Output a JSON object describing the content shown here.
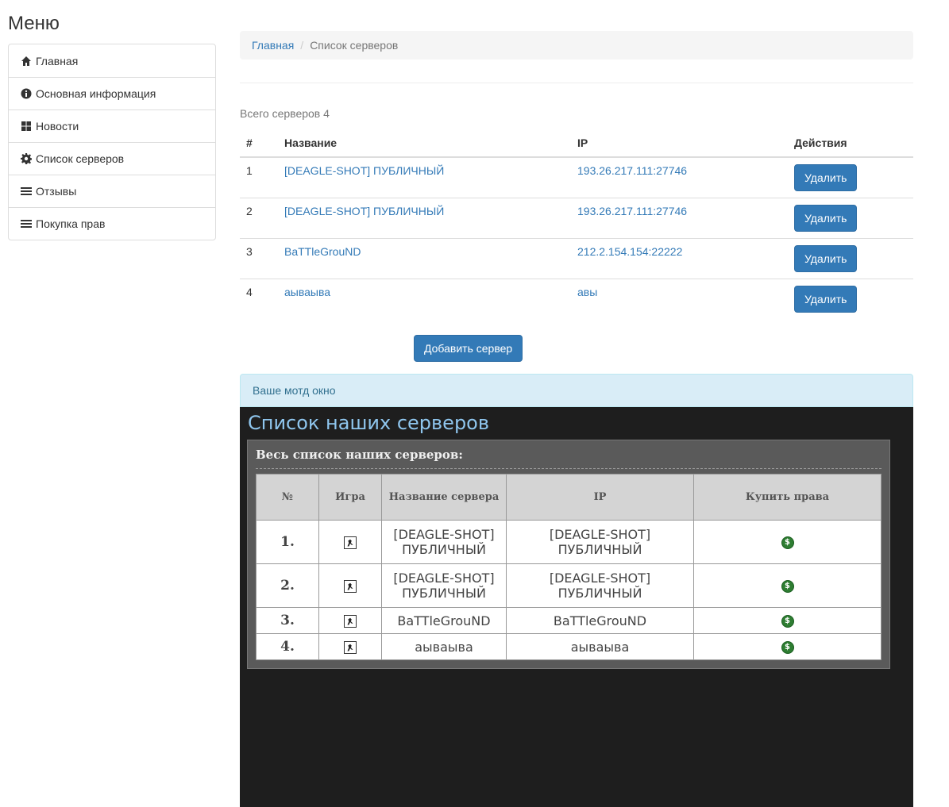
{
  "sidebar": {
    "title": "Меню",
    "items": [
      {
        "label": "Главная",
        "icon": "home-icon"
      },
      {
        "label": "Основная информация",
        "icon": "info-icon"
      },
      {
        "label": "Новости",
        "icon": "grid-icon"
      },
      {
        "label": "Список серверов",
        "icon": "gear-icon"
      },
      {
        "label": "Отзывы",
        "icon": "list-icon"
      },
      {
        "label": "Покупка прав",
        "icon": "list-icon"
      }
    ]
  },
  "breadcrumb": {
    "home": "Главная",
    "separator": "/",
    "current": "Список серверов"
  },
  "servers": {
    "total_label": "Всего серверов 4",
    "headers": {
      "num": "#",
      "name": "Название",
      "ip": "IP",
      "actions": "Действия"
    },
    "rows": [
      {
        "num": "1",
        "name": "[DEAGLE-SHOT] ПУБЛИЧНЫЙ",
        "ip": "193.26.217.111:27746",
        "action": "Удалить"
      },
      {
        "num": "2",
        "name": "[DEAGLE-SHOT] ПУБЛИЧНЫЙ",
        "ip": "193.26.217.111:27746",
        "action": "Удалить"
      },
      {
        "num": "3",
        "name": "BaTTleGrouND",
        "ip": "212.2.154.154:22222",
        "action": "Удалить"
      },
      {
        "num": "4",
        "name": "аываыва",
        "ip": "авы",
        "action": "Удалить"
      }
    ],
    "add_button": "Добавить сервер"
  },
  "motd": {
    "panel_heading": "Ваше мотд окно",
    "title": "Список наших серверов",
    "box_title": "Весь список наших серверов:",
    "headers": {
      "num": "№",
      "game": "Игра",
      "name": "Название сервера",
      "ip": "IP",
      "buy": "Купить права"
    },
    "rows": [
      {
        "num": "1.",
        "name": "[DEAGLE-SHOT] ПУБЛИЧНЫЙ",
        "ip": "[DEAGLE-SHOT] ПУБЛИЧНЫЙ"
      },
      {
        "num": "2.",
        "name": "[DEAGLE-SHOT] ПУБЛИЧНЫЙ",
        "ip": "[DEAGLE-SHOT] ПУБЛИЧНЫЙ"
      },
      {
        "num": "3.",
        "name": "BaTTleGrouND",
        "ip": "BaTTleGrouND"
      },
      {
        "num": "4.",
        "name": "аываыва",
        "ip": "аываыва"
      }
    ],
    "buy_icon_symbol": "$"
  },
  "colors": {
    "primary": "#337ab7",
    "motd_bg": "#1e1e1e",
    "motd_title": "#8fc6ee",
    "info_bg": "#d9edf7"
  }
}
